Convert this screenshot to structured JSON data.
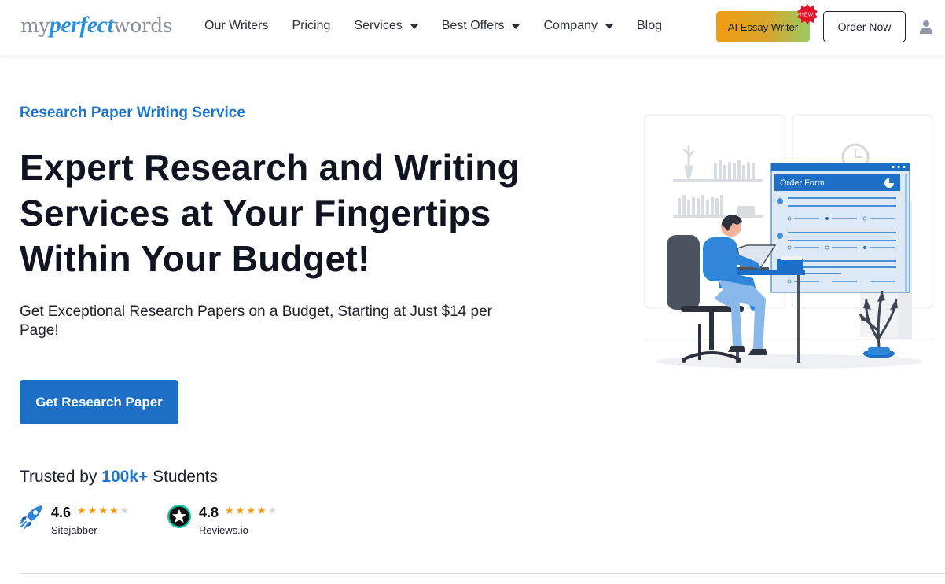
{
  "logo": {
    "my": "my",
    "perfect": "perfect",
    "words": "words"
  },
  "nav": {
    "items": [
      {
        "label": "Our Writers",
        "dropdown": false
      },
      {
        "label": "Pricing",
        "dropdown": false
      },
      {
        "label": "Services",
        "dropdown": true
      },
      {
        "label": "Best Offers",
        "dropdown": true
      },
      {
        "label": "Company",
        "dropdown": true
      },
      {
        "label": "Blog",
        "dropdown": false
      }
    ]
  },
  "header": {
    "ai_button_label": "AI Essay Writer",
    "new_badge": "NEW!",
    "order_button_label": "Order Now"
  },
  "hero": {
    "eyebrow": "Research Paper Writing Service",
    "headline_lines": [
      "Expert Research and Writing",
      "Services at Your Fingertips",
      "Within Your Budget!"
    ],
    "subtext": "Get Exceptional Research Papers on a Budget, Starting at Just $14 per Page!",
    "cta_label": "Get Research Paper"
  },
  "trust": {
    "prefix": "Trusted by ",
    "highlight": "100k+",
    "suffix": " Students"
  },
  "ratings": [
    {
      "score": "4.6",
      "stars_filled": 4,
      "stars_total": 5,
      "source": "Sitejabber",
      "icon": "sitejabber-rocket-icon"
    },
    {
      "score": "4.8",
      "stars_filled": 4,
      "stars_total": 5,
      "source": "Reviews.io",
      "icon": "reviews-io-star-icon"
    }
  ],
  "illustration": {
    "form_title": "Order Form"
  },
  "colors": {
    "brand_blue": "#1c6fc4",
    "accent_orange": "#f39a12",
    "text_dark": "#111420"
  }
}
